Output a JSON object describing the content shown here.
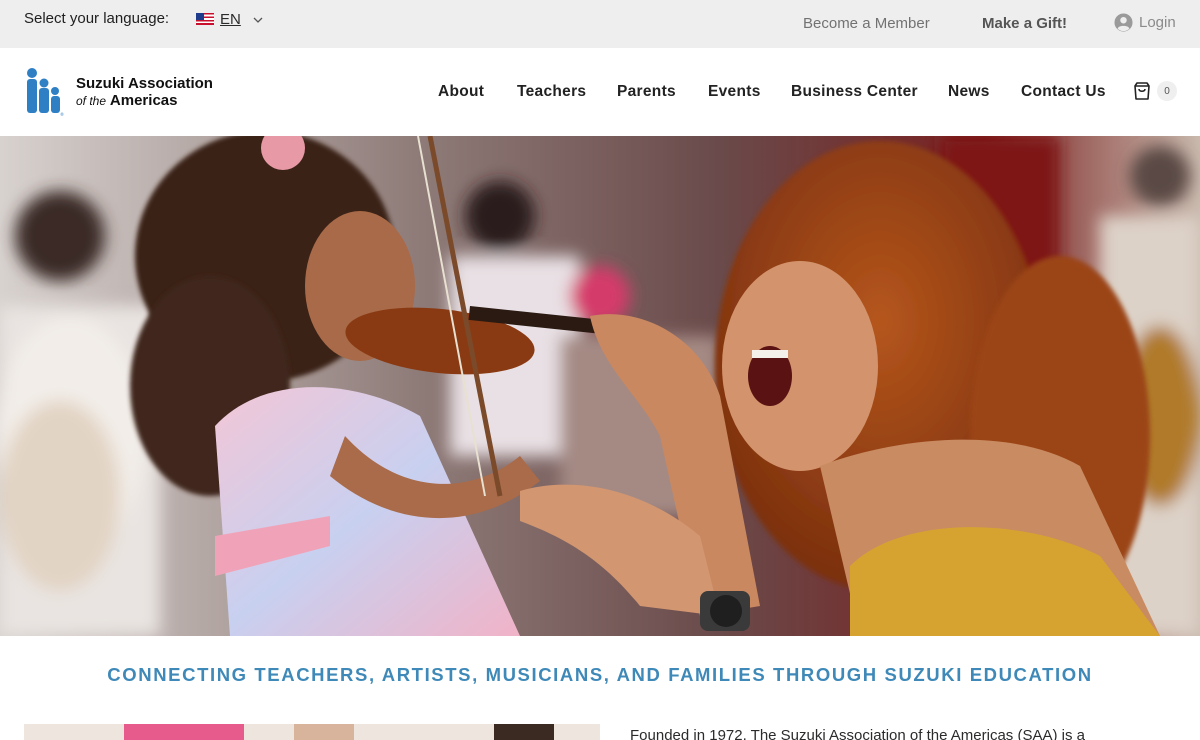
{
  "topbar": {
    "language_label": "Select your language:",
    "language_code": "EN",
    "member_link": "Become a Member",
    "gift_link": "Make a Gift!",
    "login_link": "Login"
  },
  "header": {
    "logo_line1": "Suzuki Association",
    "logo_line2_prefix": "of the",
    "logo_line2_main": "Americas",
    "nav": [
      "About",
      "Teachers",
      "Parents",
      "Events",
      "Business Center",
      "News",
      "Contact Us"
    ],
    "cart_count": "0"
  },
  "hero": {
    "image": "photo-child-violin-teacher"
  },
  "tagline": "CONNECTING TEACHERS, ARTISTS, MUSICIANS, AND FAMILIES THROUGH SUZUKI EDUCATION",
  "intro_text": "Founded in 1972, The Suzuki Association of the Americas (SAA) is a",
  "colors": {
    "accent": "#3e89b8",
    "topbar_bg": "#eeeeee",
    "logo_blue": "#2f7fc4"
  },
  "icons": {
    "flag": "us-flag-icon",
    "caret": "chevron-down-icon",
    "login": "user-circle-icon",
    "cart": "shopping-bag-icon"
  }
}
